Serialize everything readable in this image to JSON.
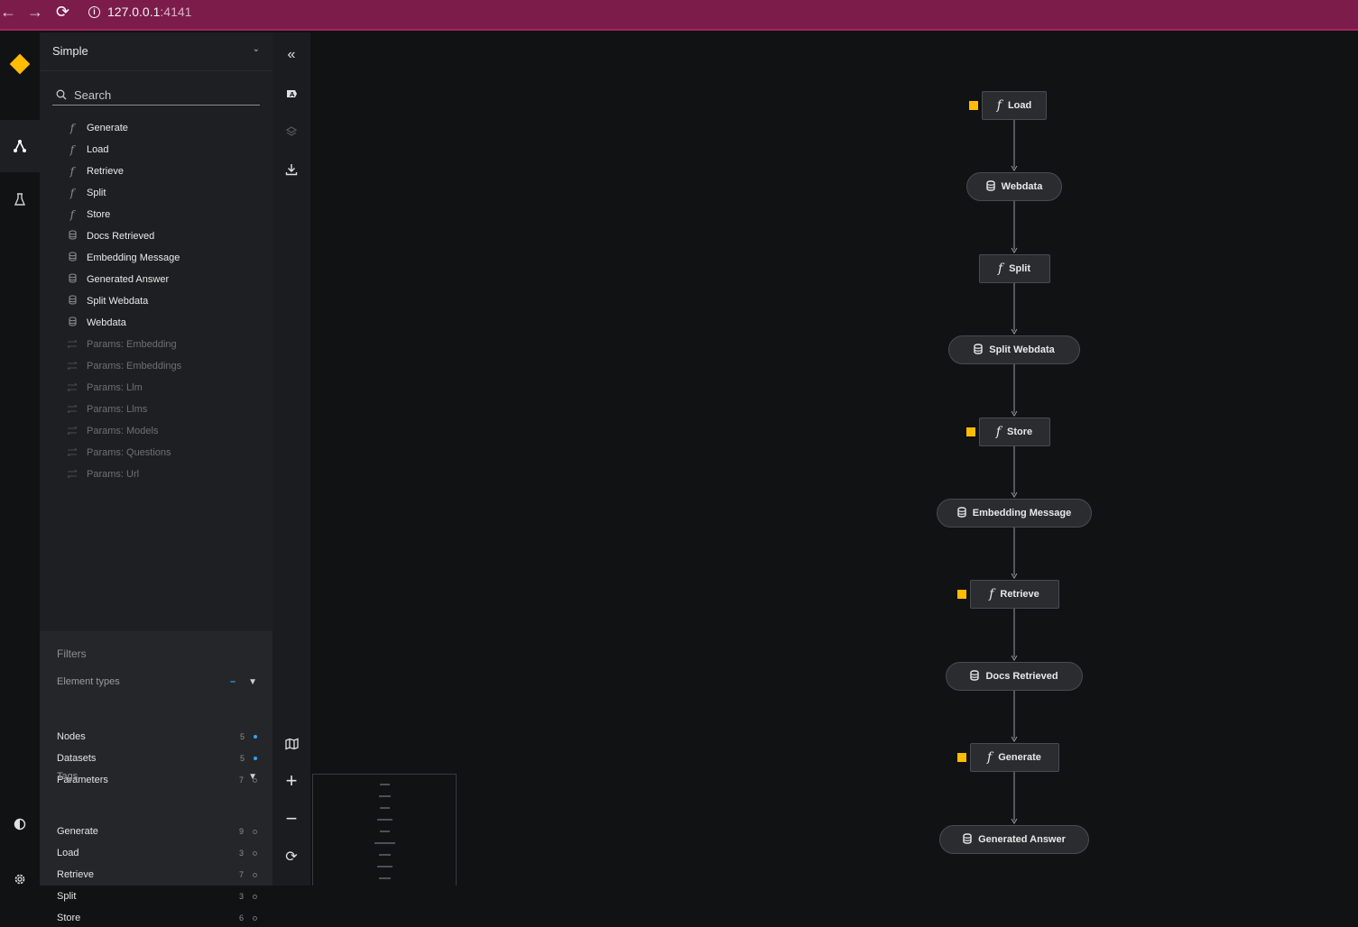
{
  "browser": {
    "url_host": "127.0.0.1",
    "url_port": ":4141",
    "back_icon": "arrow-left-icon",
    "forward_icon": "arrow-right-icon",
    "reload_icon": "reload-icon",
    "info_icon": "info-icon"
  },
  "colors": {
    "accent": "#ffbc00",
    "browser_bar": "#7c1c4a",
    "sidebar_bg": "#1e1f22",
    "canvas_bg": "#111214",
    "filter_dot": "#29a8ff"
  },
  "rail": {
    "logo_icon": "kedro-diamond-icon",
    "flowchart_icon": "flowchart-icon",
    "experiments_icon": "flask-icon",
    "theme_icon": "theme-toggle-icon",
    "settings_icon": "gear-icon"
  },
  "sidebar": {
    "pipeline": "Simple",
    "search_placeholder": "Search",
    "items": [
      {
        "label": "Generate",
        "kind": "node"
      },
      {
        "label": "Load",
        "kind": "node"
      },
      {
        "label": "Retrieve",
        "kind": "node"
      },
      {
        "label": "Split",
        "kind": "node"
      },
      {
        "label": "Store",
        "kind": "node"
      },
      {
        "label": "Docs Retrieved",
        "kind": "dataset"
      },
      {
        "label": "Embedding Message",
        "kind": "dataset"
      },
      {
        "label": "Generated Answer",
        "kind": "dataset"
      },
      {
        "label": "Split Webdata",
        "kind": "dataset"
      },
      {
        "label": "Webdata",
        "kind": "dataset"
      },
      {
        "label": "Params: Embedding",
        "kind": "parameter"
      },
      {
        "label": "Params: Embeddings",
        "kind": "parameter"
      },
      {
        "label": "Params: Llm",
        "kind": "parameter"
      },
      {
        "label": "Params: Llms",
        "kind": "parameter"
      },
      {
        "label": "Params: Models",
        "kind": "parameter"
      },
      {
        "label": "Params: Questions",
        "kind": "parameter"
      },
      {
        "label": "Params: Url",
        "kind": "parameter"
      }
    ]
  },
  "filters": {
    "heading": "Filters",
    "element_types": {
      "label": "Element types",
      "rows": [
        {
          "label": "Nodes",
          "count": "5",
          "enabled": true
        },
        {
          "label": "Datasets",
          "count": "5",
          "enabled": true
        },
        {
          "label": "Parameters",
          "count": "7",
          "enabled": false
        }
      ]
    },
    "tags": {
      "label": "Tags",
      "rows": [
        {
          "label": "Generate",
          "count": "9"
        },
        {
          "label": "Load",
          "count": "3"
        },
        {
          "label": "Retrieve",
          "count": "7"
        },
        {
          "label": "Split",
          "count": "3"
        },
        {
          "label": "Store",
          "count": "6"
        }
      ]
    }
  },
  "toolbar": {
    "collapse_icon": "collapse-sidebar-icon",
    "labels_icon": "label-toggle-icon",
    "layers_icon": "layers-icon",
    "export_icon": "download-icon",
    "map_icon": "map-icon",
    "zoom_in_icon": "plus-icon",
    "zoom_out_icon": "minus-icon",
    "reset_icon": "reset-icon"
  },
  "graph": {
    "nodes": [
      {
        "label": "Load",
        "type": "task",
        "tagged": true
      },
      {
        "label": "Webdata",
        "type": "dataset",
        "tagged": false
      },
      {
        "label": "Split",
        "type": "task",
        "tagged": false
      },
      {
        "label": "Split Webdata",
        "type": "dataset",
        "tagged": false
      },
      {
        "label": "Store",
        "type": "task",
        "tagged": true
      },
      {
        "label": "Embedding Message",
        "type": "dataset",
        "tagged": false
      },
      {
        "label": "Retrieve",
        "type": "task",
        "tagged": true
      },
      {
        "label": "Docs Retrieved",
        "type": "dataset",
        "tagged": false
      },
      {
        "label": "Generate",
        "type": "task",
        "tagged": true
      },
      {
        "label": "Generated Answer",
        "type": "dataset",
        "tagged": false
      }
    ]
  }
}
